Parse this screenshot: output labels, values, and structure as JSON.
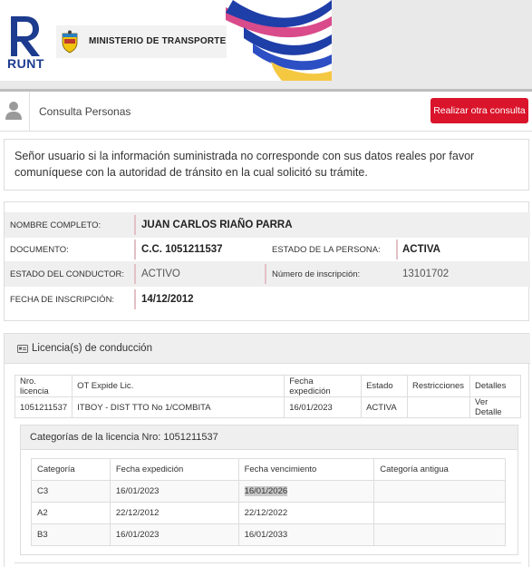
{
  "header": {
    "brand_text": "RUNT",
    "ministry_text": "MINISTERIO DE TRANSPORTE"
  },
  "consulta": {
    "title": "Consulta Personas",
    "button_label": "Realizar otra consulta"
  },
  "notice": {
    "text": "Señor usuario si la información suministrada no corresponde con sus datos reales por favor comuníquese con la autoridad de tránsito en la cual solicitó su trámite."
  },
  "person": {
    "nombre_label": "NOMBRE COMPLETO:",
    "nombre_value": "JUAN CARLOS RIAÑO PARRA",
    "documento_label": "DOCUMENTO:",
    "documento_value": "C.C. 1051211537",
    "estado_persona_label": "ESTADO DE LA PERSONA:",
    "estado_persona_value": "ACTIVA",
    "estado_conductor_label": "ESTADO DEL CONDUCTOR:",
    "estado_conductor_value": "ACTIVO",
    "inscripcion_num_label": "Número de inscripción:",
    "inscripcion_num_value": "13101702",
    "fecha_inscripcion_label": "FECHA DE INSCRIPCIÓN:",
    "fecha_inscripcion_value": "14/12/2012"
  },
  "licencias": {
    "panel_title": "Licencia(s) de conducción",
    "columns": [
      "Nro. licencia",
      "OT Expide Lic.",
      "Fecha expedición",
      "Estado",
      "Restricciones",
      "Detalles"
    ],
    "rows": [
      {
        "nro": "1051211537",
        "ot": "ITBOY - DIST TTO No 1/COMBITA",
        "fecha": "16/01/2023",
        "estado": "ACTIVA",
        "restricciones": "",
        "detalles": "Ver Detalle"
      }
    ]
  },
  "categorias": {
    "title": "Categorías de la licencia Nro: 1051211537",
    "columns": [
      "Categoría",
      "Fecha expedición",
      "Fecha vencimiento",
      "Categoría antigua"
    ],
    "rows": [
      {
        "categoria": "C3",
        "expedicion": "16/01/2023",
        "vencimiento": "16/01/2026",
        "antigua": ""
      },
      {
        "categoria": "A2",
        "expedicion": "22/12/2012",
        "vencimiento": "22/12/2022",
        "antigua": ""
      },
      {
        "categoria": "B3",
        "expedicion": "16/01/2023",
        "vencimiento": "16/01/2033",
        "antigua": ""
      }
    ]
  },
  "colors": {
    "accent_red": "#d9142b",
    "runt_blue": "#1d3c8f"
  }
}
